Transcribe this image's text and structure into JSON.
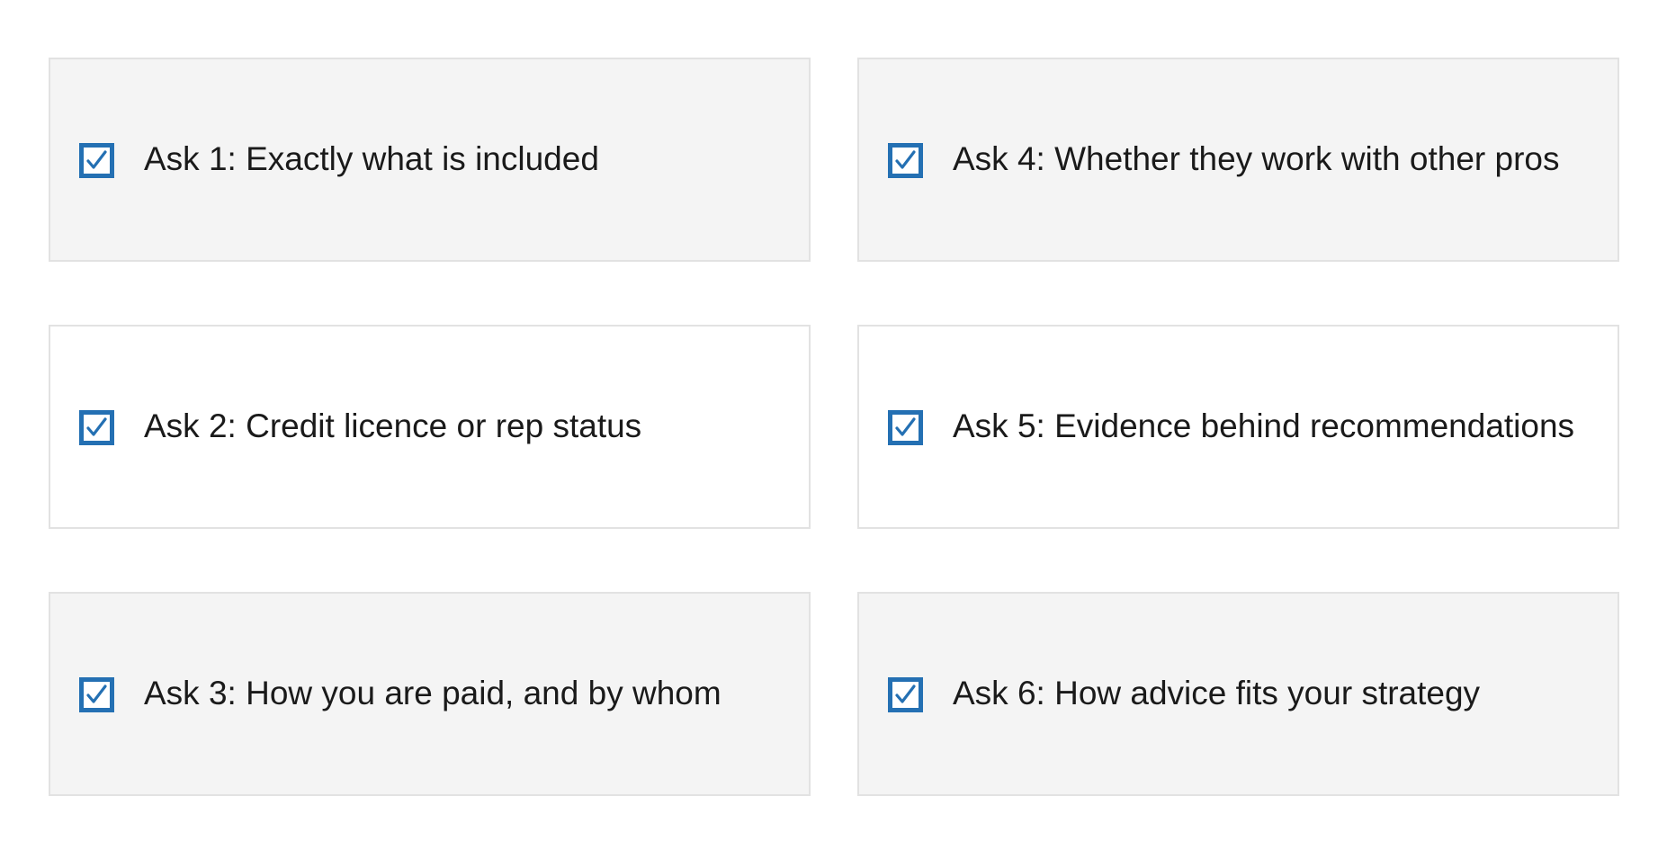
{
  "checklist": {
    "items": [
      {
        "label": "Ask 1: Exactly what is included",
        "checked": true,
        "shaded": true
      },
      {
        "label": "Ask 4: Whether they work with other pros",
        "checked": true,
        "shaded": true
      },
      {
        "label": "Ask 2: Credit licence or rep status",
        "checked": true,
        "shaded": false
      },
      {
        "label": "Ask 5: Evidence behind recommendations",
        "checked": true,
        "shaded": false
      },
      {
        "label": "Ask 3: How you are paid, and by whom",
        "checked": true,
        "shaded": true
      },
      {
        "label": "Ask 6: How advice fits your strategy",
        "checked": true,
        "shaded": true
      }
    ]
  },
  "colors": {
    "checkbox": "#2470b3",
    "card_shaded": "#f4f4f4",
    "card_plain": "#ffffff",
    "card_border": "#e2e2e2",
    "text": "#1a1a1a"
  },
  "icons": {
    "checkbox": "checkmark-icon"
  }
}
